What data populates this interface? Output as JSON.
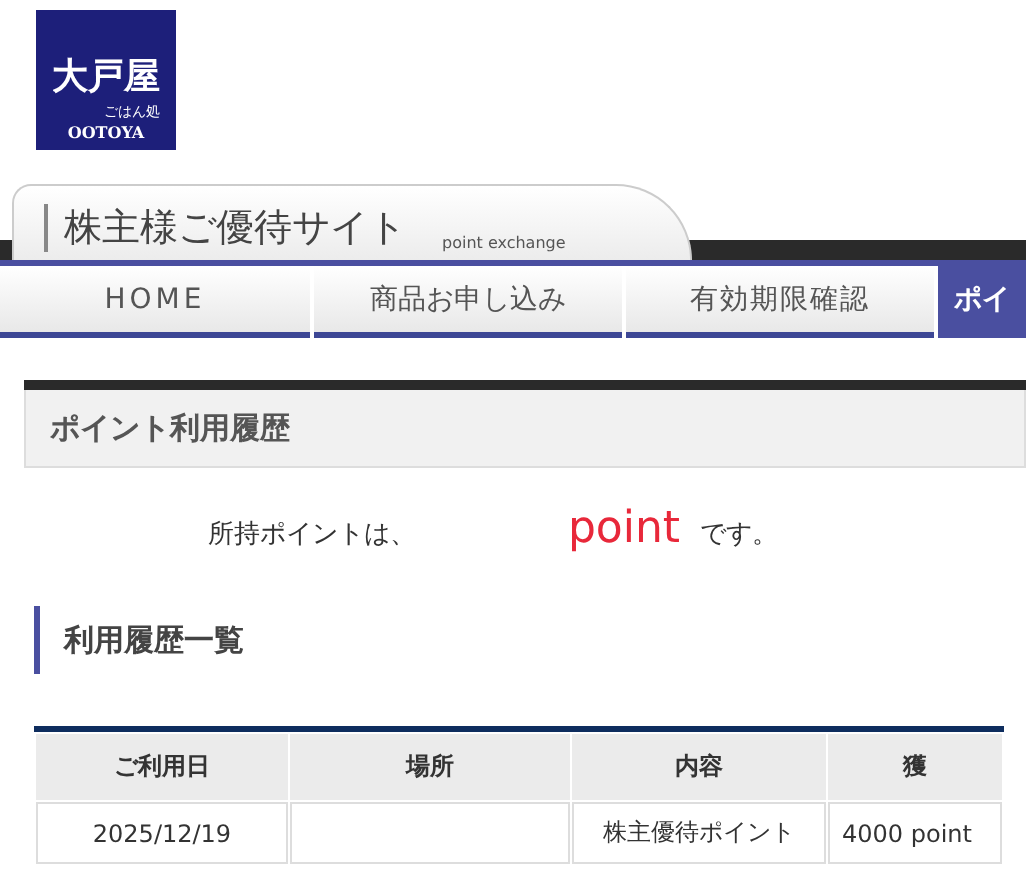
{
  "logo": {
    "mark": "大戸屋",
    "sub": "ごはん処",
    "name": "OOTOYA"
  },
  "site_header": {
    "title": "株主様ご優待サイト",
    "subtitle": "point exchange"
  },
  "nav": [
    {
      "label": "HOME",
      "selected": false
    },
    {
      "label": "商品お申し込み",
      "selected": false
    },
    {
      "label": "有効期限確認",
      "selected": false
    },
    {
      "label": "ポイ",
      "selected": true
    }
  ],
  "section_title": "ポイント利用履歴",
  "points": {
    "prefix": "所持ポイントは、",
    "unit": "point",
    "suffix": "です。"
  },
  "subheading": "利用履歴一覧",
  "table": {
    "columns": [
      "ご利用日",
      "場所",
      "内容",
      "獲"
    ],
    "rows": [
      [
        "2025/12/19",
        "",
        "株主優待ポイント",
        "4000 point"
      ]
    ]
  }
}
